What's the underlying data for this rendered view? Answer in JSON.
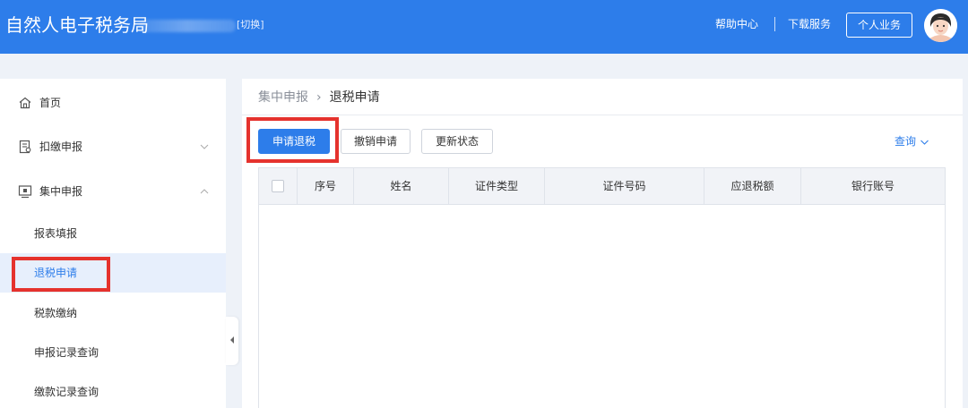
{
  "header": {
    "title": "自然人电子税务局",
    "switch_label": "[切换]",
    "help_label": "帮助中心",
    "download_label": "下载服务",
    "personal_button": "个人业务"
  },
  "sidebar": {
    "items": [
      {
        "label": "首页",
        "icon": "home-icon"
      },
      {
        "label": "扣缴申报",
        "icon": "document-icon",
        "expanded": false
      },
      {
        "label": "集中申报",
        "icon": "monitor-icon",
        "expanded": true
      }
    ],
    "sub_items": [
      {
        "label": "报表填报"
      },
      {
        "label": "退税申请",
        "active": true
      },
      {
        "label": "税款缴纳"
      },
      {
        "label": "申报记录查询"
      },
      {
        "label": "缴款记录查询"
      }
    ]
  },
  "breadcrumb": {
    "parent": "集中申报",
    "separator": "›",
    "current": "退税申请"
  },
  "toolbar": {
    "apply_refund": "申请退税",
    "cancel_application": "撤销申请",
    "refresh_status": "更新状态",
    "query": "查询"
  },
  "table": {
    "columns": [
      "",
      "序号",
      "姓名",
      "证件类型",
      "证件号码",
      "应退税额",
      "银行账号"
    ],
    "rows": []
  },
  "colors": {
    "primary": "#2d7dea",
    "highlight": "#e5322d",
    "active_bg": "#e7effc"
  }
}
